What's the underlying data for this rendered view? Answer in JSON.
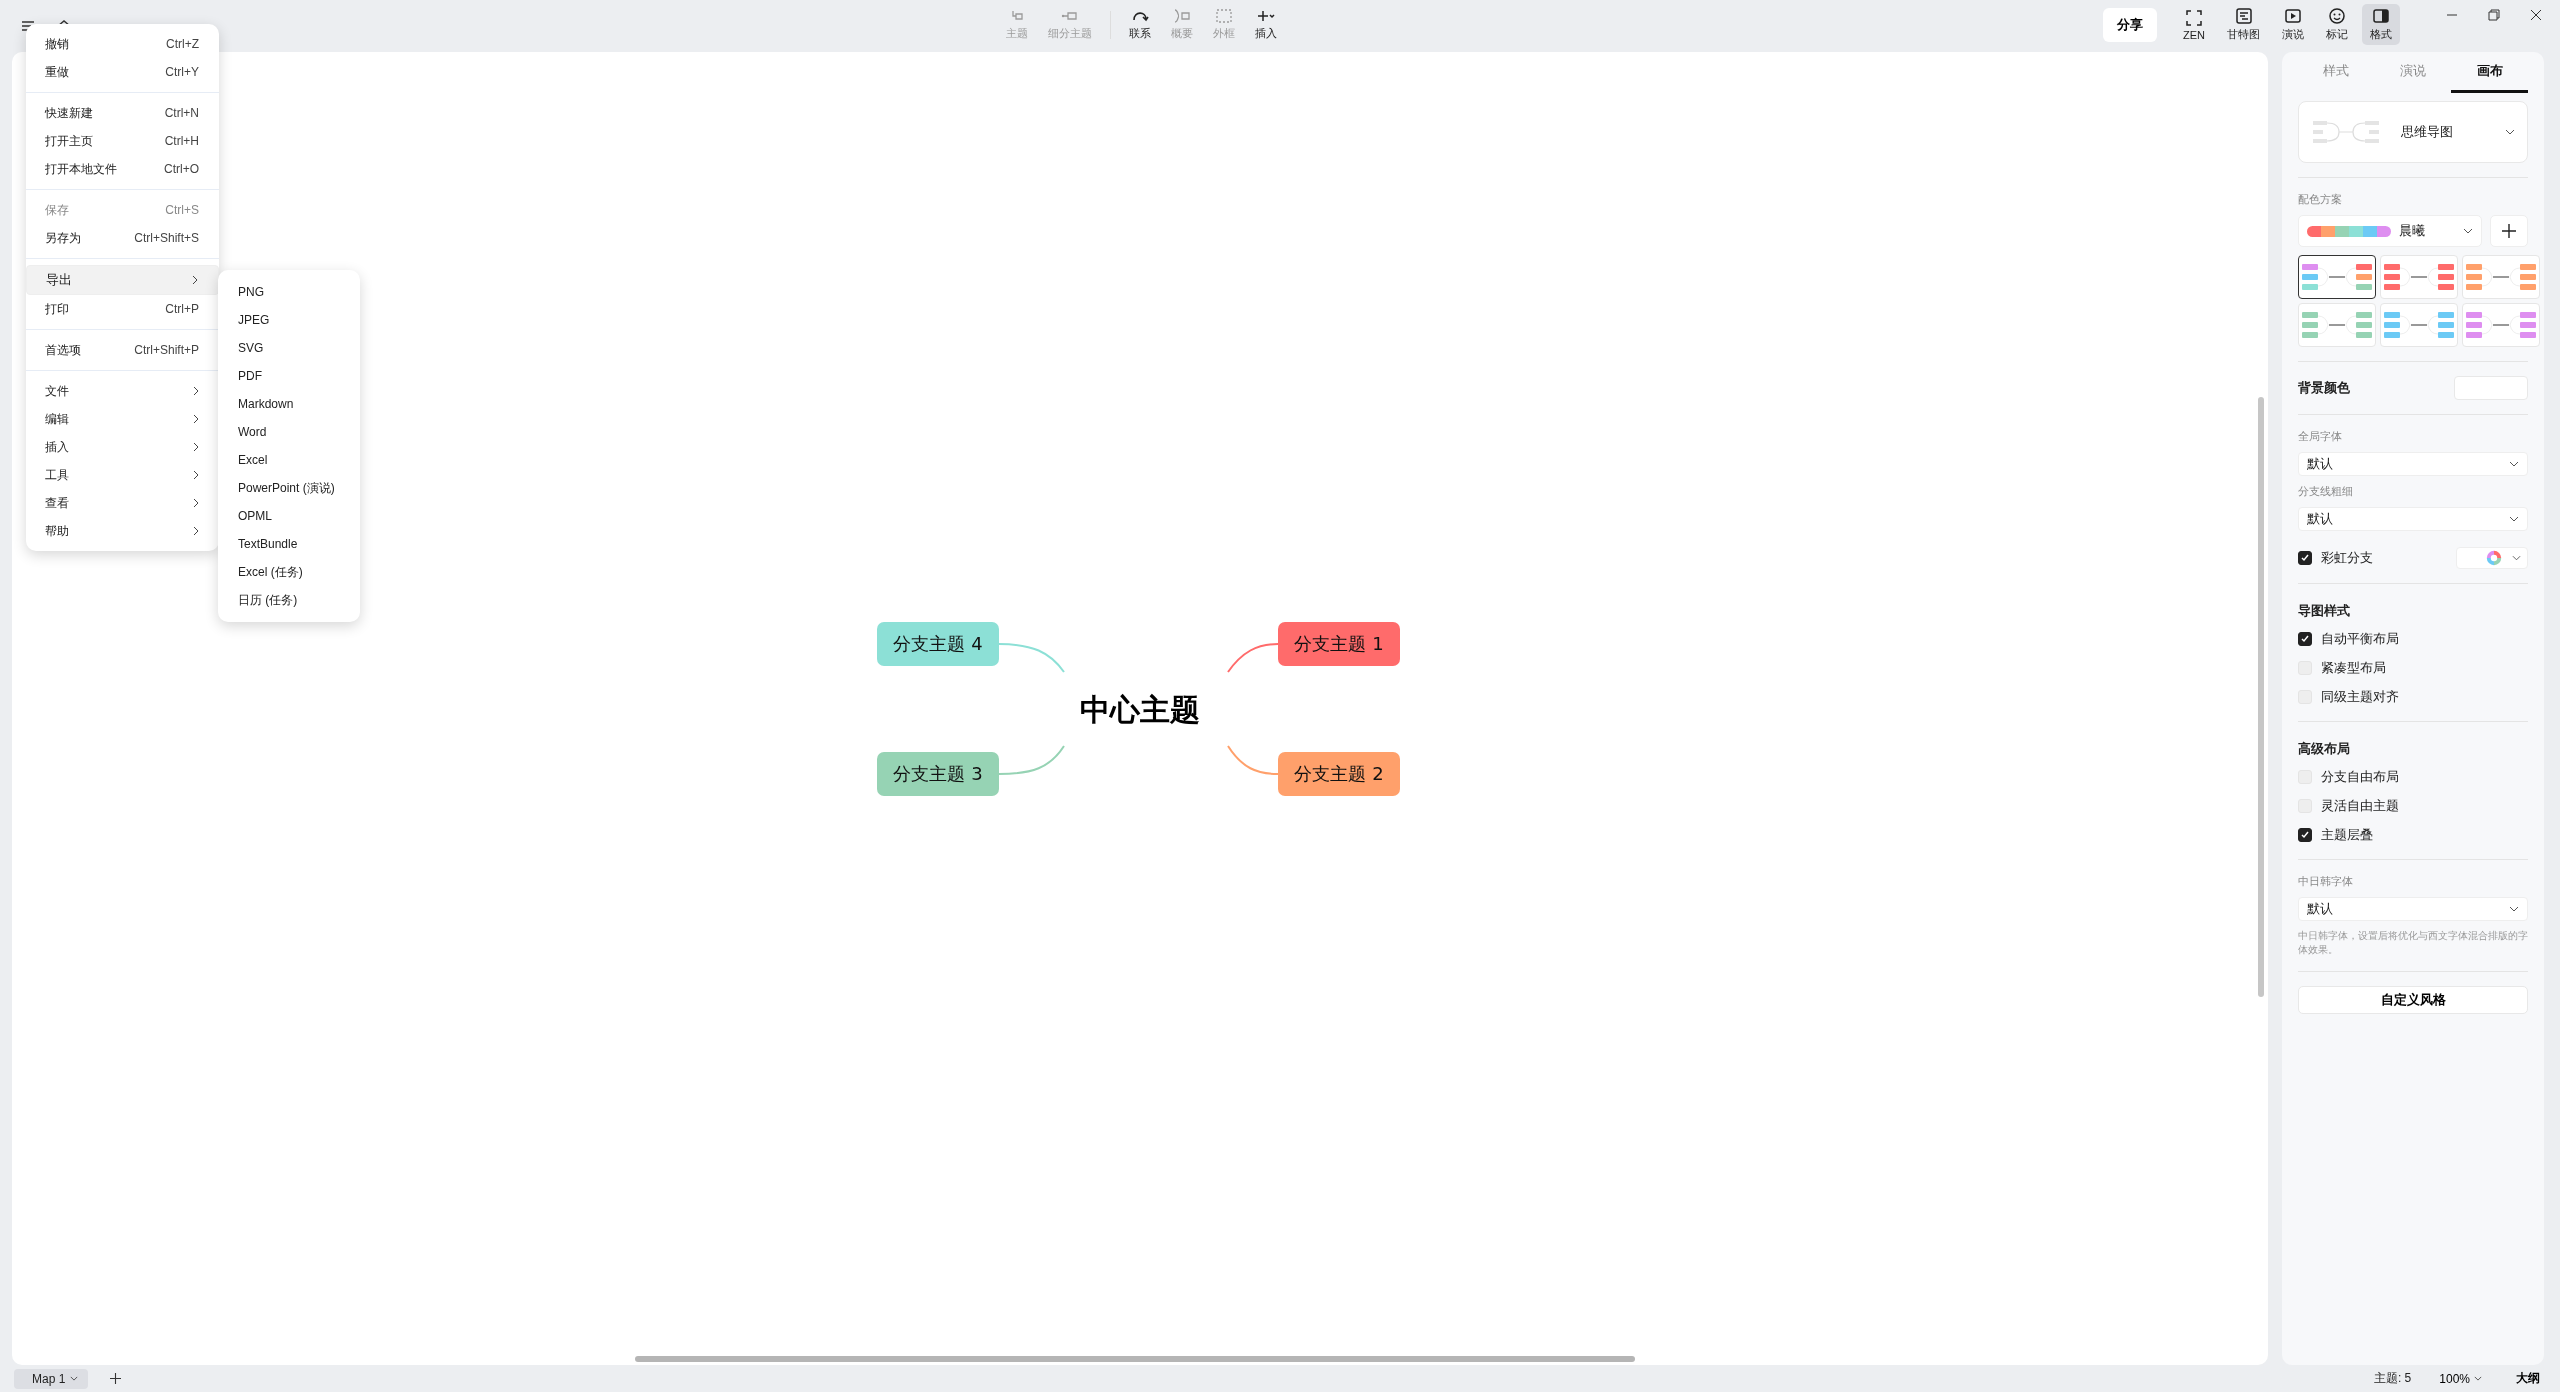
{
  "toolbar": [
    {
      "label": "主题",
      "disabled": true,
      "kind": "topic"
    },
    {
      "label": "细分主题",
      "disabled": true,
      "kind": "subtopic"
    },
    {
      "label": "联系",
      "disabled": false,
      "kind": "relation"
    },
    {
      "label": "概要",
      "disabled": true,
      "kind": "summary"
    },
    {
      "label": "外框",
      "disabled": true,
      "kind": "boundary"
    },
    {
      "label": "插入",
      "disabled": false,
      "kind": "insert"
    }
  ],
  "share_button": "分享",
  "view_tools": [
    {
      "label": "ZEN",
      "kind": "zen",
      "selected": false
    },
    {
      "label": "甘特图",
      "kind": "gantt",
      "selected": false
    },
    {
      "label": "演说",
      "kind": "pitch",
      "selected": false
    },
    {
      "label": "标记",
      "kind": "marker",
      "selected": false
    },
    {
      "label": "格式",
      "kind": "format",
      "selected": true
    }
  ],
  "menu": [
    [
      {
        "label": "撤销",
        "shortcut": "Ctrl+Z",
        "submenu": false,
        "disabled": false,
        "selected": false
      },
      {
        "label": "重做",
        "shortcut": "Ctrl+Y",
        "submenu": false,
        "disabled": false,
        "selected": false
      }
    ],
    [
      {
        "label": "快速新建",
        "shortcut": "Ctrl+N",
        "submenu": false,
        "disabled": false,
        "selected": false
      },
      {
        "label": "打开主页",
        "shortcut": "Ctrl+H",
        "submenu": false,
        "disabled": false,
        "selected": false
      },
      {
        "label": "打开本地文件",
        "shortcut": "Ctrl+O",
        "submenu": false,
        "disabled": false,
        "selected": false
      }
    ],
    [
      {
        "label": "保存",
        "shortcut": "Ctrl+S",
        "submenu": false,
        "disabled": true,
        "selected": false
      },
      {
        "label": "另存为",
        "shortcut": "Ctrl+Shift+S",
        "submenu": false,
        "disabled": false,
        "selected": false
      }
    ],
    [
      {
        "label": "导出",
        "submenu": true,
        "disabled": false,
        "selected": true
      },
      {
        "label": "打印",
        "shortcut": "Ctrl+P",
        "submenu": false,
        "disabled": false,
        "selected": false
      }
    ],
    [
      {
        "label": "首选项",
        "shortcut": "Ctrl+Shift+P",
        "submenu": false,
        "disabled": false,
        "selected": false
      }
    ],
    [
      {
        "label": "文件",
        "submenu": true,
        "disabled": false,
        "selected": false
      },
      {
        "label": "编辑",
        "submenu": true,
        "disabled": false,
        "selected": false
      },
      {
        "label": "插入",
        "submenu": true,
        "disabled": false,
        "selected": false
      },
      {
        "label": "工具",
        "submenu": true,
        "disabled": false,
        "selected": false
      },
      {
        "label": "查看",
        "submenu": true,
        "disabled": false,
        "selected": false
      },
      {
        "label": "帮助",
        "submenu": true,
        "disabled": false,
        "selected": false
      }
    ]
  ],
  "export_submenu": [
    "PNG",
    "JPEG",
    "SVG",
    "PDF",
    "Markdown",
    "Word",
    "Excel",
    "PowerPoint (演说)",
    "OPML",
    "TextBundle",
    "Excel (任务)",
    "日历 (任务)"
  ],
  "mind_map": {
    "central_topic": "中心主题",
    "branches": [
      {
        "label": "分支主题 4",
        "color": "#8ce0d6"
      },
      {
        "label": "分支主题 1",
        "color": "#ff6b6b"
      },
      {
        "label": "分支主题 3",
        "color": "#96d3b4"
      },
      {
        "label": "分支主题 2",
        "color": "#ffa06b"
      }
    ]
  },
  "panel": {
    "tabs": [
      {
        "label": "样式",
        "selected": false
      },
      {
        "label": "演说",
        "selected": false
      },
      {
        "label": "画布",
        "selected": true
      }
    ],
    "structure": "思维导图",
    "palette_label": "配色方案",
    "palette": {
      "name": "晨曦",
      "swatches": [
        {
          "color": "#ff6b6b"
        },
        {
          "color": "#ffa06b"
        },
        {
          "color": "#96d3b4"
        },
        {
          "color": "#8ce0d6"
        },
        {
          "color": "#6ccaf5"
        },
        {
          "color": "#de8ef0"
        }
      ]
    },
    "themes": [
      {
        "selected": true,
        "branches": [
          {
            "color": "#de8ef0"
          },
          {
            "color": "#ff6b6b"
          },
          {
            "color": "#6ccaf5"
          },
          {
            "color": "#ffa06b"
          },
          {
            "color": "#8ce0d6"
          },
          {
            "color": "#96d3b4"
          }
        ]
      },
      {
        "selected": false,
        "branches": [
          {
            "color": "#ff6b6b"
          },
          {
            "color": "#ff6b6b"
          },
          {
            "color": "#ff6b6b"
          },
          {
            "color": "#ff6b6b"
          },
          {
            "color": "#ff6b6b"
          },
          {
            "color": "#ff6b6b"
          }
        ]
      },
      {
        "selected": false,
        "branches": [
          {
            "color": "#ffa06b"
          },
          {
            "color": "#ffa06b"
          },
          {
            "color": "#ffa06b"
          },
          {
            "color": "#ffa06b"
          },
          {
            "color": "#ffa06b"
          },
          {
            "color": "#ffa06b"
          }
        ]
      },
      {
        "selected": false,
        "branches": [
          {
            "color": "#96d3b4"
          },
          {
            "color": "#96d3b4"
          },
          {
            "color": "#96d3b4"
          },
          {
            "color": "#96d3b4"
          },
          {
            "color": "#96d3b4"
          },
          {
            "color": "#96d3b4"
          }
        ]
      },
      {
        "selected": false,
        "branches": [
          {
            "color": "#6ccaf5"
          },
          {
            "color": "#6ccaf5"
          },
          {
            "color": "#6ccaf5"
          },
          {
            "color": "#6ccaf5"
          },
          {
            "color": "#6ccaf5"
          },
          {
            "color": "#6ccaf5"
          }
        ]
      },
      {
        "selected": false,
        "branches": [
          {
            "color": "#de8ef0"
          },
          {
            "color": "#de8ef0"
          },
          {
            "color": "#de8ef0"
          },
          {
            "color": "#de8ef0"
          },
          {
            "color": "#de8ef0"
          },
          {
            "color": "#de8ef0"
          }
        ]
      }
    ],
    "background_label": "背景颜色",
    "font_label": "全局字体",
    "font_value": "默认",
    "line_label": "分支线粗细",
    "line_value": "默认",
    "rainbow": {
      "label": "彩虹分支",
      "checked": true
    },
    "map_style_heading": "导图样式",
    "map_style": [
      {
        "label": "自动平衡布局",
        "checked": true
      },
      {
        "label": "紧凑型布局",
        "checked": false
      },
      {
        "label": "同级主题对齐",
        "checked": false
      }
    ],
    "advanced_heading": "高级布局",
    "advanced": [
      {
        "label": "分支自由布局",
        "checked": false
      },
      {
        "label": "灵活自由主题",
        "checked": false
      },
      {
        "label": "主题层叠",
        "checked": true
      }
    ],
    "cjk_label": "中日韩字体",
    "cjk_value": "默认",
    "cjk_hint": "中日韩字体，设置后将优化与西文字体混合排版的字体效果。",
    "custom_button": "自定义风格"
  },
  "status_bar": {
    "sheet_tab": "Map 1",
    "topic_count": "主题: 5",
    "zoom": "100%",
    "outline": "大纲"
  }
}
